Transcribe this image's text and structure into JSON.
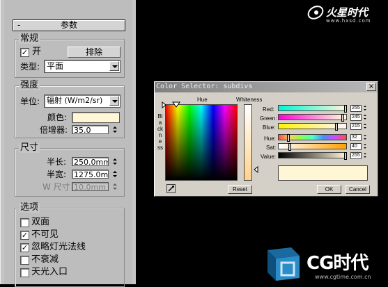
{
  "watermark_top": {
    "brand": "火星时代",
    "url": "www.hxsd.com"
  },
  "watermark_bottom": {
    "brand": "CG时代",
    "url": "www.cgtime.com.cn"
  },
  "panel": {
    "rollout_title": "参数",
    "rollout_minus": "-",
    "general": {
      "label": "常规",
      "on_label": "开",
      "on_checked": "✓",
      "exclude_button": "排除",
      "type_label": "类型:",
      "type_value": "平面"
    },
    "intensity": {
      "label": "强度",
      "unit_label": "单位:",
      "unit_value": "辐射 (W/m2/sr)",
      "color_label": "颜色:",
      "color_value": "#fff6d6",
      "multiplier_label": "倍增器:",
      "multiplier_value": "35.0"
    },
    "dimensions": {
      "label": "尺寸",
      "half_length_label": "半长:",
      "half_length_value": "250.0mm",
      "half_width_label": "半宽:",
      "half_width_value": "1275.0mm",
      "w_size_label": "W 尺寸",
      "w_size_value": "10.0mm"
    },
    "options": {
      "label": "选项",
      "items": [
        {
          "label": "双面",
          "mark": ""
        },
        {
          "label": "不可见",
          "mark": "✓"
        },
        {
          "label": "忽略灯光法线",
          "mark": "✓"
        },
        {
          "label": "不衰减",
          "mark": ""
        },
        {
          "label": "天光入口",
          "mark": ""
        }
      ]
    }
  },
  "color_selector": {
    "title": "Color Selector: subdivs",
    "close_glyph": "×",
    "hue_label": "Hue",
    "whiteness_label": "Whiteness",
    "blackness_label": "Blackness",
    "red_label": "Red:",
    "red_value": "255",
    "green_label": "Green:",
    "green_value": "245",
    "blue_label": "Blue:",
    "blue_value": "215",
    "hue_label2": "Hue:",
    "hue_value": "32",
    "sat_label": "Sat:",
    "sat_value": "40",
    "value_label": "Value:",
    "value_value": "255",
    "reset_button": "Reset",
    "ok_button": "OK",
    "cancel_button": "Cancel",
    "current_color": "#fff6d6"
  }
}
